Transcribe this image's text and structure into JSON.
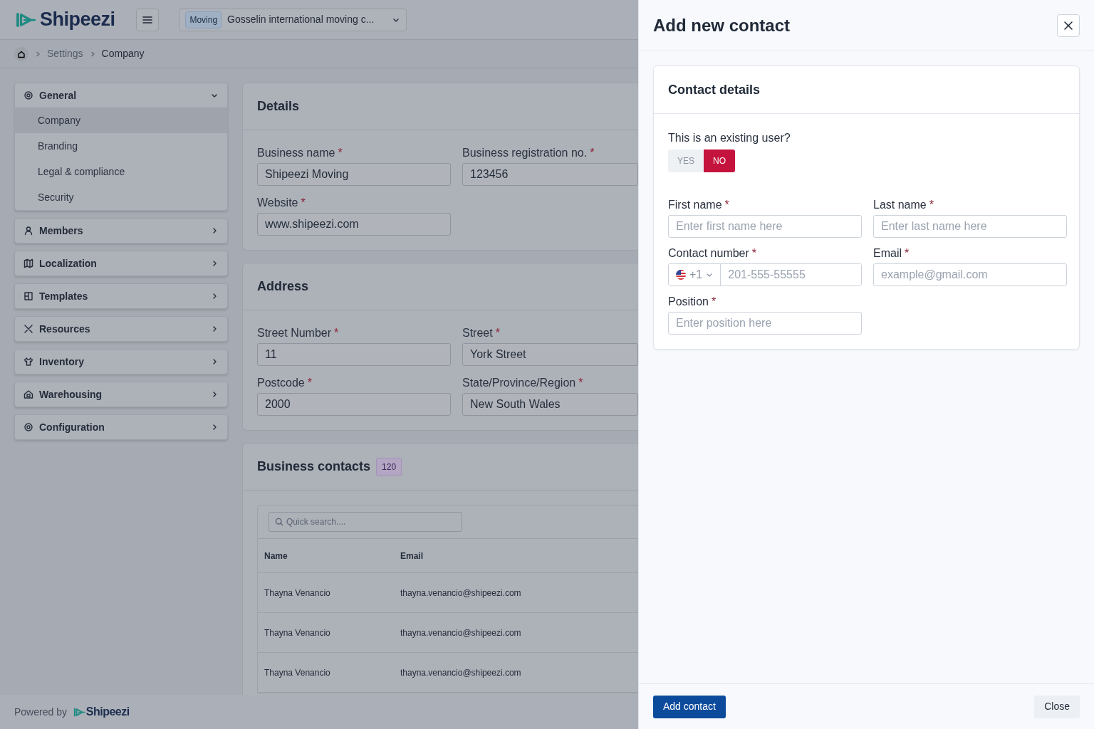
{
  "header": {
    "logo": "Shipeezi",
    "company_selector": {
      "badge": "Moving",
      "value": "Gosselin international moving c..."
    }
  },
  "breadcrumb": [
    {
      "label": "Settings",
      "current": false
    },
    {
      "label": "Company",
      "current": true
    }
  ],
  "sidebar": {
    "groups": [
      {
        "label": "General",
        "expanded": true,
        "items": [
          {
            "label": "Company",
            "selected": true
          },
          {
            "label": "Branding",
            "selected": false
          },
          {
            "label": "Legal & compliance",
            "selected": false
          },
          {
            "label": "Security",
            "selected": false
          }
        ]
      },
      {
        "label": "Members",
        "expanded": false
      },
      {
        "label": "Localization",
        "expanded": false
      },
      {
        "label": "Templates",
        "expanded": false
      },
      {
        "label": "Resources",
        "expanded": false
      },
      {
        "label": "Inventory",
        "expanded": false
      },
      {
        "label": "Warehousing",
        "expanded": false
      },
      {
        "label": "Configuration",
        "expanded": false
      }
    ]
  },
  "sections": [
    {
      "title": "Details",
      "fields": [
        {
          "label": "Business name",
          "required_mark": "*",
          "value": "Shipeezi Moving"
        },
        {
          "label": "Business registration no.",
          "required_mark": "*",
          "value": "123456"
        },
        {
          "label": "Website",
          "required_mark": "*",
          "value": "www.shipeezi.com"
        }
      ]
    },
    {
      "title": "Address",
      "fields": [
        {
          "label": "Street Number",
          "required_mark": "*",
          "value": "11"
        },
        {
          "label": "Street",
          "required_mark": "*",
          "value": "York Street"
        },
        {
          "label": "Postcode",
          "required_mark": "*",
          "value": "2000"
        },
        {
          "label": "State/Province/Region",
          "required_mark": "*",
          "value": "New South Wales"
        }
      ]
    }
  ],
  "business_contacts": {
    "title": "Business contacts",
    "count": "120",
    "search": {
      "placeholder": "Quick search...."
    },
    "table": {
      "columns": [
        "Name",
        "Email"
      ],
      "rows": [
        [
          "Thayna Venancio",
          "thayna.venancio@shipeezi.com"
        ],
        [
          "Thayna Venancio",
          "thayna.venancio@shipeezi.com"
        ],
        [
          "Thayna Venancio",
          "thayna.venancio@shipeezi.com"
        ]
      ]
    }
  },
  "footer": {
    "text": "Powered by",
    "logo": "Shipeezi"
  },
  "panel": {
    "title": "Add new contact",
    "section_title": "Contact details",
    "existing_user": {
      "label": "This is an existing user?",
      "options": [
        {
          "label": "YES",
          "selected": false
        },
        {
          "label": "NO",
          "selected": true
        }
      ]
    },
    "fields": [
      {
        "kind": "text",
        "label": "First name",
        "required_mark": "*",
        "placeholder": "Enter first name here"
      },
      {
        "kind": "text",
        "label": "Last name",
        "required_mark": "*",
        "placeholder": "Enter last name here"
      },
      {
        "kind": "phone",
        "label": "Contact number",
        "required_mark": "*",
        "prefix": "+1",
        "placeholder": "201-555-55555"
      },
      {
        "kind": "text",
        "label": "Email",
        "required_mark": "*",
        "placeholder": "example@gmail.com"
      },
      {
        "kind": "text",
        "label": "Position",
        "required_mark": "*",
        "placeholder": "Enter position here"
      }
    ],
    "buttons": [
      {
        "label": "Add contact",
        "kind": "primary"
      },
      {
        "label": "Close",
        "kind": "secondary"
      }
    ]
  }
}
